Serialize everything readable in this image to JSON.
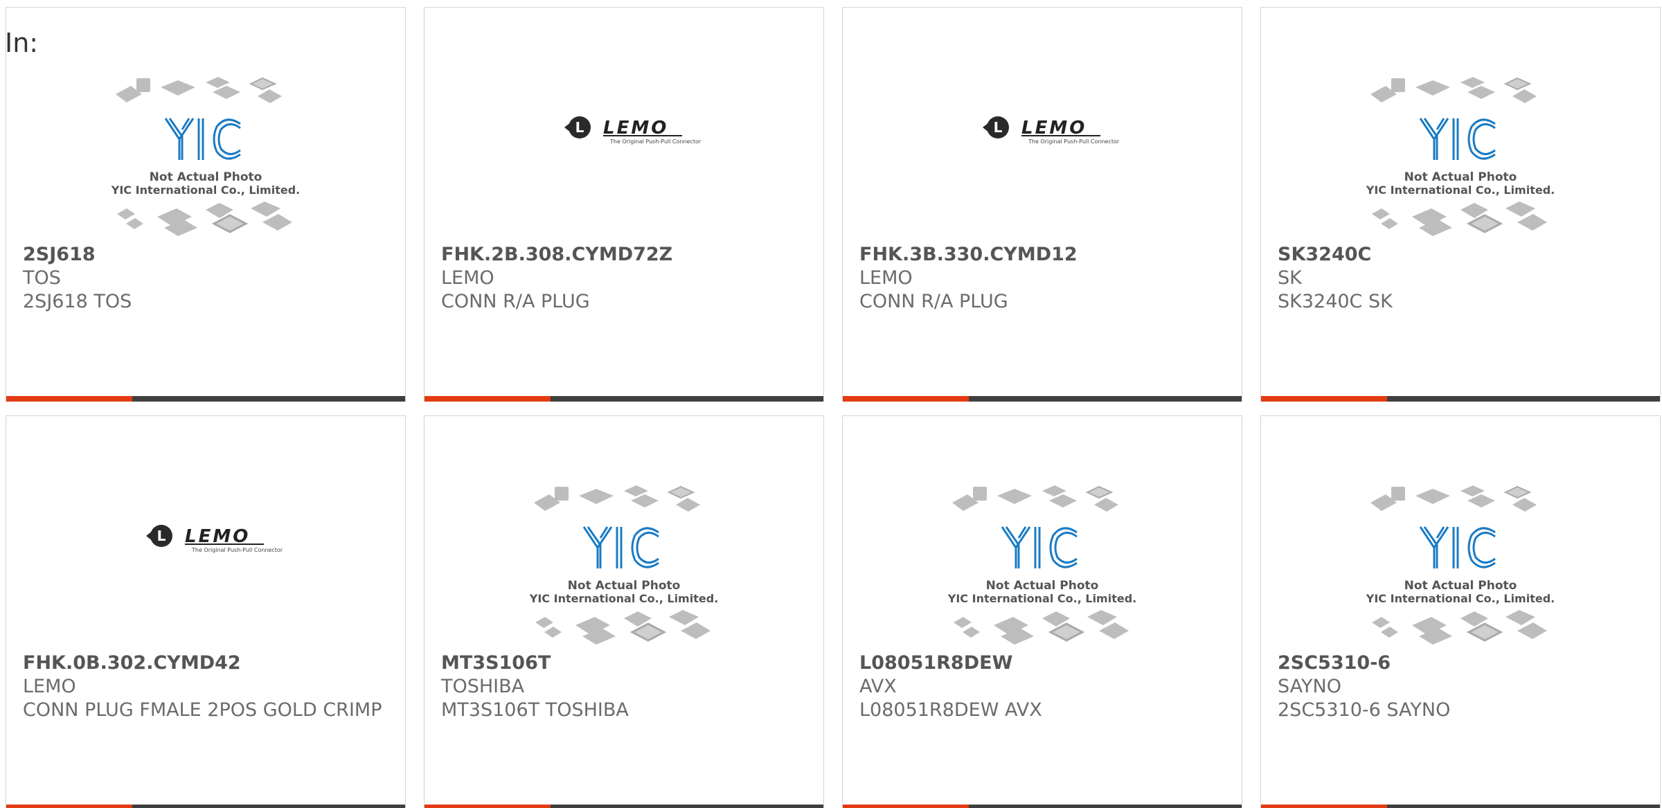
{
  "label": "In:",
  "colors": {
    "accent": "#e33b12",
    "bar": "#3f3f3f",
    "border": "#d4d4d4",
    "yic_blue": "#1a7bc4"
  },
  "placeholder": {
    "line1": "Not Actual Photo",
    "line2": "YIC International Co., Limited.",
    "logo_text": "YIC"
  },
  "lemo": {
    "brand": "LEMO",
    "tagline": "The Original Push-Pull Connector"
  },
  "products": [
    {
      "part": "2SJ618",
      "manufacturer": "TOS",
      "description": "2SJ618 TOS",
      "image": "yic-placeholder"
    },
    {
      "part": "FHK.2B.308.CYMD72Z",
      "manufacturer": "LEMO",
      "description": "CONN R/A PLUG",
      "image": "lemo-logo"
    },
    {
      "part": "FHK.3B.330.CYMD12",
      "manufacturer": "LEMO",
      "description": "CONN R/A PLUG",
      "image": "lemo-logo"
    },
    {
      "part": "SK3240C",
      "manufacturer": "SK",
      "description": "SK3240C SK",
      "image": "yic-placeholder"
    },
    {
      "part": "FHK.0B.302.CYMD42",
      "manufacturer": "LEMO",
      "description": "CONN PLUG FMALE 2POS GOLD CRIMP",
      "image": "lemo-logo"
    },
    {
      "part": "MT3S106T",
      "manufacturer": "TOSHIBA",
      "description": "MT3S106T TOSHIBA",
      "image": "yic-placeholder"
    },
    {
      "part": "L08051R8DEW",
      "manufacturer": "AVX",
      "description": "L08051R8DEW AVX",
      "image": "yic-placeholder"
    },
    {
      "part": "2SC5310-6",
      "manufacturer": "SAYNO",
      "description": "2SC5310-6 SAYNO",
      "image": "yic-placeholder"
    }
  ]
}
